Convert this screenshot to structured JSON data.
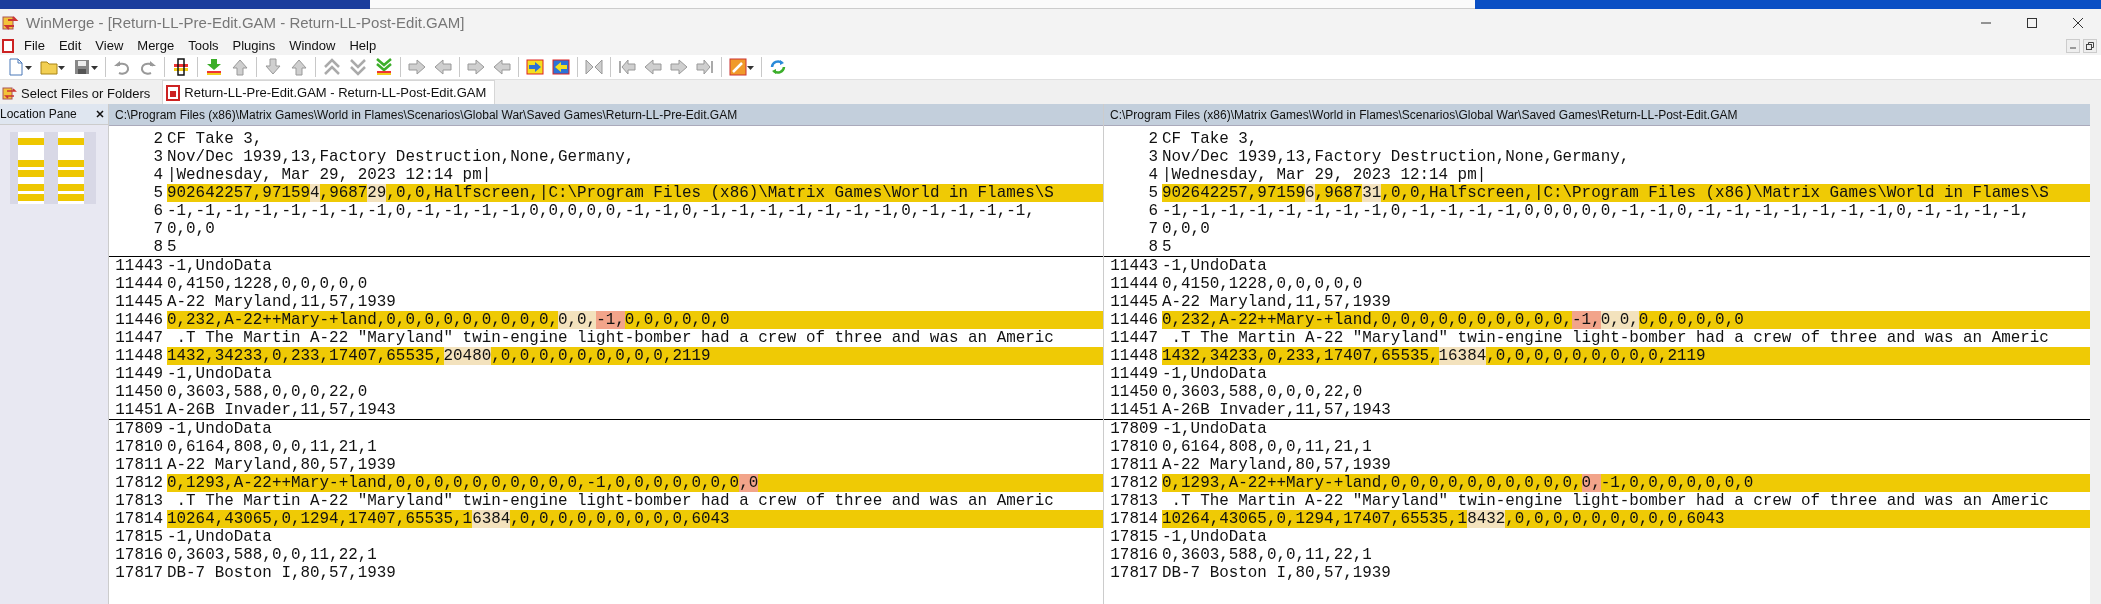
{
  "window": {
    "title": "WinMerge - [Return-LL-Pre-Edit.GAM - Return-LL-Post-Edit.GAM]"
  },
  "menu": [
    "File",
    "Edit",
    "View",
    "Merge",
    "Tools",
    "Plugins",
    "Window",
    "Help"
  ],
  "tabs": [
    {
      "label": "Select Files or Folders",
      "kind": "open",
      "selected": false
    },
    {
      "label": "Return-LL-Pre-Edit.GAM - Return-LL-Post-Edit.GAM",
      "kind": "compare",
      "selected": true
    }
  ],
  "location_pane": {
    "title": "Location Pane"
  },
  "panes": [
    {
      "path": "C:\\Program Files (x86)\\Matrix Games\\World in Flames\\Scenarios\\Global War\\Saved Games\\Return-LL-Pre-Edit.GAM",
      "sections": [
        {
          "lines": [
            {
              "number": "2",
              "diff": false,
              "text": "CF Take 3,"
            },
            {
              "number": "3",
              "diff": false,
              "text": "Nov/Dec 1939,13,Factory Destruction,None,Germany,"
            },
            {
              "number": "4",
              "diff": false,
              "text": "|Wednesday, Mar 29, 2023 12:14 pm|"
            },
            {
              "number": "5",
              "diff": true,
              "segments": [
                {
                  "text": "902642257,97159",
                  "kind": "same"
                },
                {
                  "text": "4",
                  "kind": "word"
                },
                {
                  "text": ",9687",
                  "kind": "same"
                },
                {
                  "text": "29",
                  "kind": "word"
                },
                {
                  "text": ",0,0,Halfscreen,|C:\\Program Files (x86)\\Matrix Games\\World in Flames\\S",
                  "kind": "same"
                }
              ]
            },
            {
              "number": "6",
              "diff": false,
              "text": "-1,-1,-1,-1,-1,-1,-1,-1,0,-1,-1,-1,-1,0,0,0,0,0,-1,-1,0,-1,-1,-1,-1,-1,-1,-1,0,-1,-1,-1,-1,"
            },
            {
              "number": "7",
              "diff": false,
              "text": "0,0,0"
            },
            {
              "number": "8",
              "diff": false,
              "text": "5"
            }
          ]
        },
        {
          "lines": [
            {
              "number": "11443",
              "diff": false,
              "text": "-1,UndoData"
            },
            {
              "number": "11444",
              "diff": false,
              "text": "0,4150,1228,0,0,0,0,0"
            },
            {
              "number": "11445",
              "diff": false,
              "text": "A-22 Maryland,11,57,1939"
            },
            {
              "number": "11446",
              "diff": true,
              "segments": [
                {
                  "text": "0,232,A-22++Mary-+land,0,0,0,0,0,0,0,0,0,",
                  "kind": "same"
                },
                {
                  "text": "0,0,",
                  "kind": "word"
                },
                {
                  "text": "-1,",
                  "kind": "removed"
                },
                {
                  "text": "0,0,0,0,0,0",
                  "kind": "same"
                }
              ]
            },
            {
              "number": "11447",
              "diff": false,
              "text": " .T The Martin A-22 \"Maryland\" twin-engine light-bomber had a crew of three and was an Americ"
            },
            {
              "number": "11448",
              "diff": true,
              "segments": [
                {
                  "text": "1432,34233,0,233,17407,65535,",
                  "kind": "same"
                },
                {
                  "text": "20480",
                  "kind": "word"
                },
                {
                  "text": ",0,0,0,0,0,0,0,0,0,2119",
                  "kind": "same"
                }
              ]
            },
            {
              "number": "11449",
              "diff": false,
              "text": "-1,UndoData"
            },
            {
              "number": "11450",
              "diff": false,
              "text": "0,3603,588,0,0,0,22,0"
            },
            {
              "number": "11451",
              "diff": false,
              "text": "A-26B Invader,11,57,1943"
            }
          ]
        },
        {
          "lines": [
            {
              "number": "17809",
              "diff": false,
              "text": "-1,UndoData"
            },
            {
              "number": "17810",
              "diff": false,
              "text": "0,6164,808,0,0,11,21,1"
            },
            {
              "number": "17811",
              "diff": false,
              "text": "A-22 Maryland,80,57,1939"
            },
            {
              "number": "17812",
              "diff": true,
              "segments": [
                {
                  "text": "0,1293,A-22++Mary-+land,0,0,0,0,0,0,0,0,0,0,-1,0,0,0,0,0,0,0",
                  "kind": "same"
                },
                {
                  "text": ",0",
                  "kind": "removed"
                }
              ]
            },
            {
              "number": "17813",
              "diff": false,
              "text": " .T The Martin A-22 \"Maryland\" twin-engine light-bomber had a crew of three and was an Americ"
            },
            {
              "number": "17814",
              "diff": true,
              "segments": [
                {
                  "text": "10264,43065,0,1294,17407,65535,1",
                  "kind": "same"
                },
                {
                  "text": "6384",
                  "kind": "word"
                },
                {
                  "text": ",0,0,0,0,0,0,0,0,0,6043",
                  "kind": "same"
                }
              ]
            },
            {
              "number": "17815",
              "diff": false,
              "text": "-1,UndoData"
            },
            {
              "number": "17816",
              "diff": false,
              "text": "0,3603,588,0,0,11,22,1"
            },
            {
              "number": "17817",
              "diff": false,
              "text": "DB-7 Boston I,80,57,1939"
            }
          ]
        }
      ]
    },
    {
      "path": "C:\\Program Files (x86)\\Matrix Games\\World in Flames\\Scenarios\\Global War\\Saved Games\\Return-LL-Post-Edit.GAM",
      "sections": [
        {
          "lines": [
            {
              "number": "2",
              "diff": false,
              "text": "CF Take 3,"
            },
            {
              "number": "3",
              "diff": false,
              "text": "Nov/Dec 1939,13,Factory Destruction,None,Germany,"
            },
            {
              "number": "4",
              "diff": false,
              "text": "|Wednesday, Mar 29, 2023 12:14 pm|"
            },
            {
              "number": "5",
              "diff": true,
              "segments": [
                {
                  "text": "902642257,97159",
                  "kind": "same"
                },
                {
                  "text": "6",
                  "kind": "word"
                },
                {
                  "text": ",9687",
                  "kind": "same"
                },
                {
                  "text": "31",
                  "kind": "word"
                },
                {
                  "text": ",0,0,Halfscreen,|C:\\Program Files (x86)\\Matrix Games\\World in Flames\\S",
                  "kind": "same"
                }
              ]
            },
            {
              "number": "6",
              "diff": false,
              "text": "-1,-1,-1,-1,-1,-1,-1,-1,0,-1,-1,-1,-1,0,0,0,0,0,-1,-1,0,-1,-1,-1,-1,-1,-1,-1,0,-1,-1,-1,-1,"
            },
            {
              "number": "7",
              "diff": false,
              "text": "0,0,0"
            },
            {
              "number": "8",
              "diff": false,
              "text": "5"
            }
          ]
        },
        {
          "lines": [
            {
              "number": "11443",
              "diff": false,
              "text": "-1,UndoData"
            },
            {
              "number": "11444",
              "diff": false,
              "text": "0,4150,1228,0,0,0,0,0"
            },
            {
              "number": "11445",
              "diff": false,
              "text": "A-22 Maryland,11,57,1939"
            },
            {
              "number": "11446",
              "diff": true,
              "segments": [
                {
                  "text": "0,232,A-22++Mary-+land,0,0,0,0,0,0,0,0,0,0,",
                  "kind": "same"
                },
                {
                  "text": "-1,",
                  "kind": "removed"
                },
                {
                  "text": "0,0,",
                  "kind": "word"
                },
                {
                  "text": "0,0,0,0,0,0",
                  "kind": "same"
                }
              ]
            },
            {
              "number": "11447",
              "diff": false,
              "text": " .T The Martin A-22 \"Maryland\" twin-engine light-bomber had a crew of three and was an Americ"
            },
            {
              "number": "11448",
              "diff": true,
              "segments": [
                {
                  "text": "1432,34233,0,233,17407,65535,",
                  "kind": "same"
                },
                {
                  "text": "16384",
                  "kind": "word"
                },
                {
                  "text": ",0,0,0,0,0,0,0,0,0,2119",
                  "kind": "same"
                }
              ]
            },
            {
              "number": "11449",
              "diff": false,
              "text": "-1,UndoData"
            },
            {
              "number": "11450",
              "diff": false,
              "text": "0,3603,588,0,0,0,22,0"
            },
            {
              "number": "11451",
              "diff": false,
              "text": "A-26B Invader,11,57,1943"
            }
          ]
        },
        {
          "lines": [
            {
              "number": "17809",
              "diff": false,
              "text": "-1,UndoData"
            },
            {
              "number": "17810",
              "diff": false,
              "text": "0,6164,808,0,0,11,21,1"
            },
            {
              "number": "17811",
              "diff": false,
              "text": "A-22 Maryland,80,57,1939"
            },
            {
              "number": "17812",
              "diff": true,
              "segments": [
                {
                  "text": "0,1293,A-22++Mary-+land,0,0,0,0,0,0,0,0,0,0,",
                  "kind": "same"
                },
                {
                  "text": "0,",
                  "kind": "removed"
                },
                {
                  "text": "-1,0,0,0,0,0,0,0",
                  "kind": "same"
                }
              ]
            },
            {
              "number": "17813",
              "diff": false,
              "text": " .T The Martin A-22 \"Maryland\" twin-engine light-bomber had a crew of three and was an Americ"
            },
            {
              "number": "17814",
              "diff": true,
              "segments": [
                {
                  "text": "10264,43065,0,1294,17407,65535,1",
                  "kind": "same"
                },
                {
                  "text": "8432",
                  "kind": "word"
                },
                {
                  "text": ",0,0,0,0,0,0,0,0,0,6043",
                  "kind": "same"
                }
              ]
            },
            {
              "number": "17815",
              "diff": false,
              "text": "-1,UndoData"
            },
            {
              "number": "17816",
              "diff": false,
              "text": "0,3603,588,0,0,11,22,1"
            },
            {
              "number": "17817",
              "diff": false,
              "text": "DB-7 Boston I,80,57,1939"
            }
          ]
        }
      ]
    }
  ]
}
